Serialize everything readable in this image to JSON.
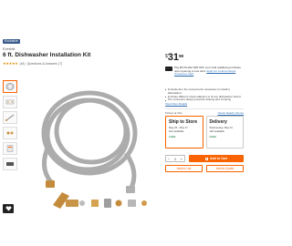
{
  "product": {
    "badge": "Exclusive",
    "brand": "Everbilt",
    "title": "6 ft. Dishwasher Installation Kit",
    "rating_text": "(44)",
    "meta_text": "Questions & Answers (7)",
    "stars": "★★★★★"
  },
  "thumbnails": [
    {
      "name": "thumb-hose-coil",
      "active": true
    },
    {
      "name": "thumb-kit-contents",
      "active": false
    },
    {
      "name": "thumb-hose-ends",
      "active": false
    },
    {
      "name": "thumb-fittings",
      "active": false
    },
    {
      "name": "thumb-package",
      "active": false
    },
    {
      "name": "thumb-detail",
      "active": false
    }
  ],
  "price": {
    "dollar": "$",
    "whole": "31",
    "cents": "98"
  },
  "promo": {
    "text": "Pay $0.00 after $25 OFF your total qualifying purchase upon opening a new card.",
    "link": "Apply for a Home Depot Consumer Card"
  },
  "features": [
    "Includes ALL the components necessary to install a dishwasher",
    "Includes different sized adapters to fit any dishwasher brand",
    "The connector design prevents kinking and crimping"
  ],
  "see_more": "View More Details",
  "pickup": {
    "label": "Pickup at Orlo",
    "store_link": "Check Nearby Stores"
  },
  "options": [
    {
      "title": "Ship to Store",
      "line1": "May 26 - May 27",
      "line2": "102 available",
      "free": "FREE",
      "selected": true
    },
    {
      "title": "Delivery",
      "line1": "Wednesday, May 24",
      "line2": "102 available",
      "free": "FREE",
      "selected": false
    }
  ],
  "quantity": {
    "minus": "−",
    "value": "1",
    "plus": "+"
  },
  "buttons": {
    "add_to_cart": "Add to Cart",
    "add_to_list": "Add to List",
    "add_to_quote": "Add to Quote"
  },
  "colors": {
    "brand_orange": "#f96302",
    "badge_blue": "#3b5b8c",
    "link_blue": "#2b6cb0"
  }
}
